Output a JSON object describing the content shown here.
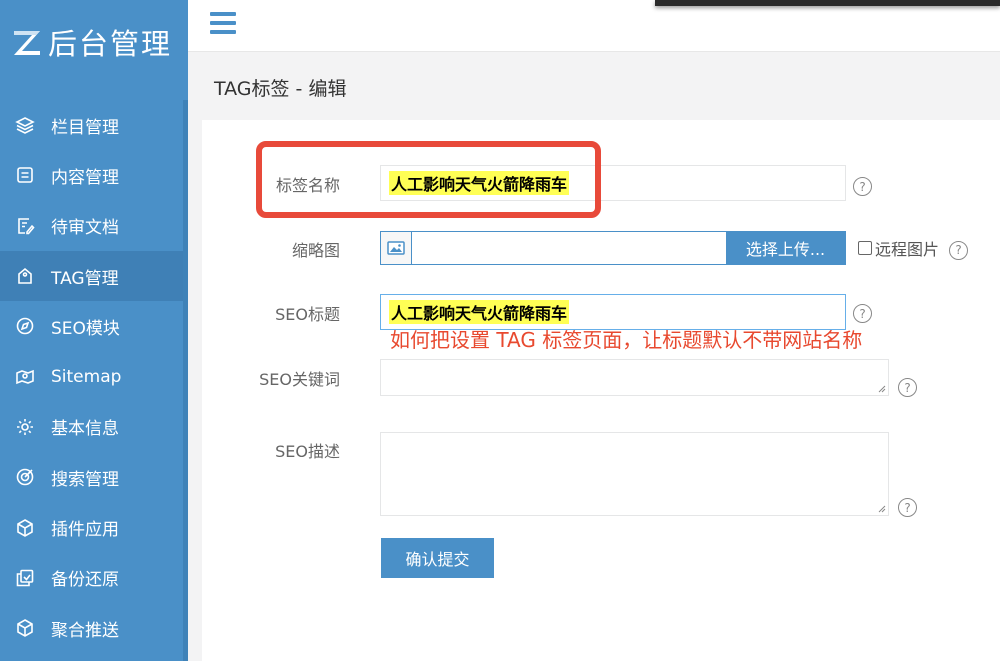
{
  "sidebar": {
    "logo_letter": "Z",
    "logo_text": "后台管理",
    "items": [
      {
        "label": "栏目管理",
        "icon": "layers-icon",
        "active": false
      },
      {
        "label": "内容管理",
        "icon": "list-icon",
        "active": false
      },
      {
        "label": "待审文档",
        "icon": "edit-doc-icon",
        "active": false
      },
      {
        "label": "TAG管理",
        "icon": "tag-icon",
        "active": true
      },
      {
        "label": "SEO模块",
        "icon": "compass-icon",
        "active": false
      },
      {
        "label": "Sitemap",
        "icon": "map-icon",
        "active": false
      },
      {
        "label": "基本信息",
        "icon": "gear-icon",
        "active": false
      },
      {
        "label": "搜索管理",
        "icon": "target-icon",
        "active": false
      },
      {
        "label": "插件应用",
        "icon": "cube-icon",
        "active": false
      },
      {
        "label": "备份还原",
        "icon": "backup-icon",
        "active": false
      },
      {
        "label": "聚合推送",
        "icon": "cube-icon",
        "active": false
      }
    ]
  },
  "page": {
    "title": "TAG标签 - 编辑"
  },
  "form": {
    "tag_name_label": "标签名称",
    "tag_name_value": "人工影响天气火箭降雨车",
    "thumbnail_label": "缩略图",
    "upload_button": "选择上传...",
    "remote_image_label": "远程图片",
    "seo_title_label": "SEO标题",
    "seo_title_value": "人工影响天气火箭降雨车",
    "seo_keywords_label": "SEO关键词",
    "seo_description_label": "SEO描述",
    "help_glyph": "?",
    "submit_button": "确认提交"
  },
  "annotation": {
    "text": "如何把设置 TAG 标签页面，让标题默认不带网站名称",
    "color": "#e8492f"
  },
  "colors": {
    "sidebar_bg": "#4a90c8",
    "accent": "#4a90c8",
    "highlight": "#ffff55",
    "red_box": "#e84a3a"
  }
}
